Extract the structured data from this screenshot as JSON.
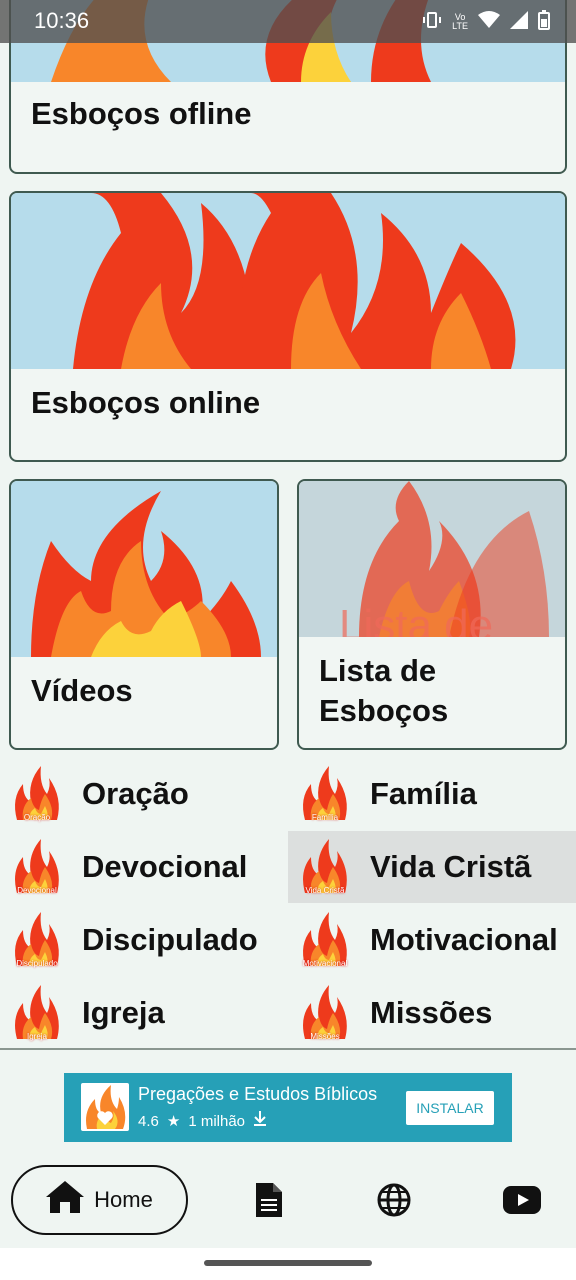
{
  "status": {
    "time": "10:36",
    "network": "LTE"
  },
  "cards": {
    "offline": "Esboços ofline",
    "online": "Esboços online",
    "videos": "Vídeos",
    "lista": "Lista de\nEsboços",
    "lista_overlay": "Lista de"
  },
  "grid": [
    {
      "label": "Oração",
      "icon_text": "Oração"
    },
    {
      "label": "Família",
      "icon_text": "Família"
    },
    {
      "label": "Devocional",
      "icon_text": "Devocional"
    },
    {
      "label": "Vida Cristã",
      "icon_text": "Vida Cristã"
    },
    {
      "label": "Discipulado",
      "icon_text": "Discipulado"
    },
    {
      "label": "Motivacional",
      "icon_text": "Motivacional"
    },
    {
      "label": "Igreja",
      "icon_text": "Igreja"
    },
    {
      "label": "Missões",
      "icon_text": "Missões"
    }
  ],
  "ad": {
    "title": "Pregações e Estudos Bíblicos",
    "rating": "4.6",
    "downloads": "1 milhão",
    "button": "INSTALAR"
  },
  "nav": {
    "home": "Home",
    "icons": [
      "document-icon",
      "globe-icon",
      "youtube-icon"
    ]
  },
  "colors": {
    "accent": "#26a0b7",
    "card_border": "#3f5a50",
    "sky": "#b6dceb",
    "flame_red": "#ee3a1c",
    "flame_orange": "#f8862a",
    "flame_yellow": "#fcd23b"
  }
}
